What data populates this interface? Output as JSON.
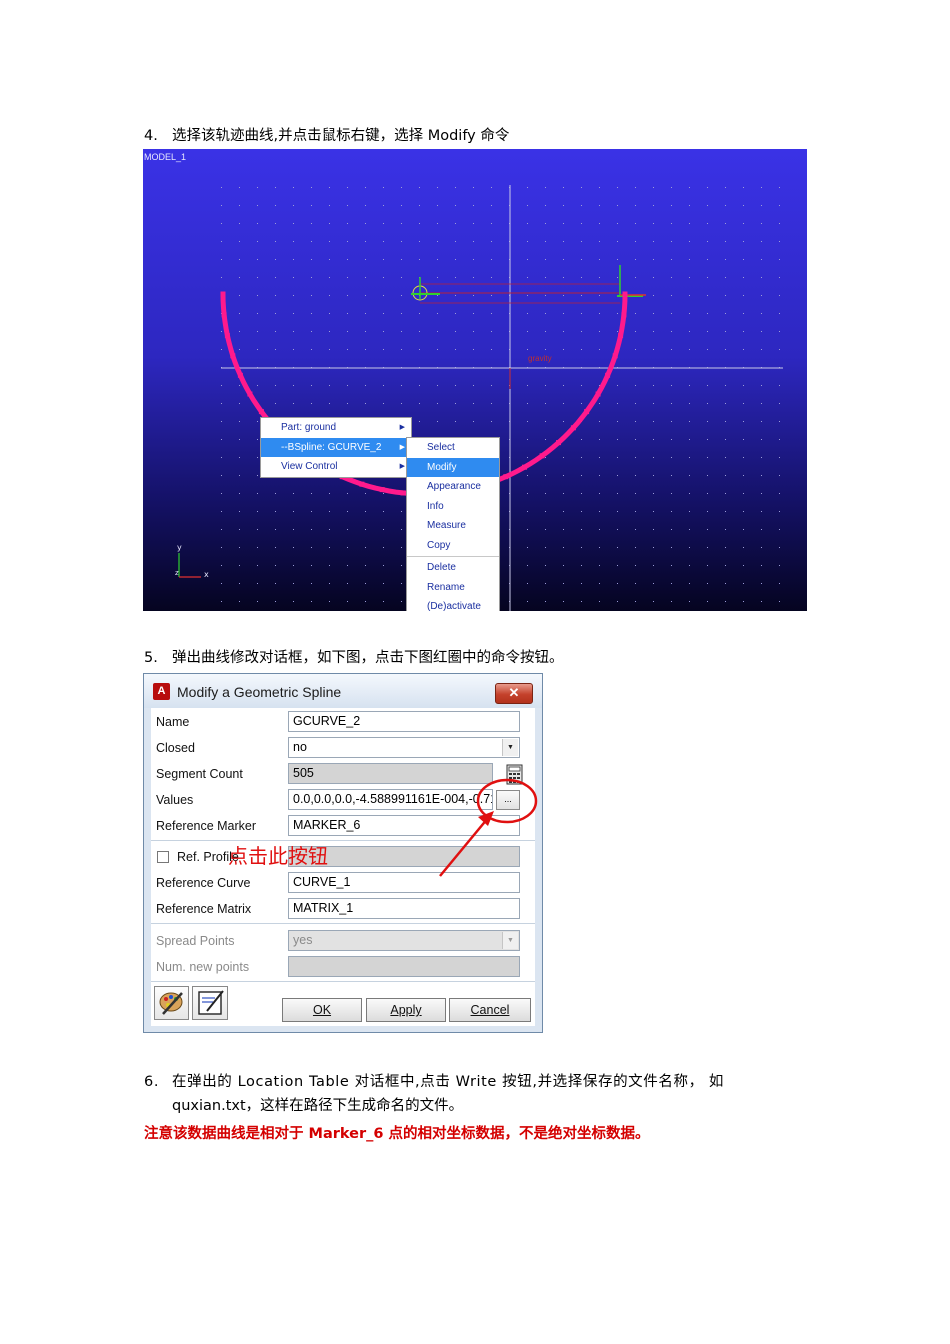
{
  "step4": {
    "num": "4.",
    "text": "选择该轨迹曲线,并点击鼠标右键，选择 Modify 命令"
  },
  "viewport": {
    "model_label": "MODEL_1",
    "gravity_label": "gravity",
    "axis_y": "y",
    "axis_x": "x",
    "axis_z": "z",
    "colors": {
      "curve": "#ff1a8c",
      "background_top": "#3a32e6",
      "background_bottom": "#050420",
      "highlight": "#2f8bf0"
    }
  },
  "context_menu": {
    "items": [
      {
        "label": "Part: ground"
      },
      {
        "label": "--BSpline: GCURVE_2"
      },
      {
        "label": "View Control"
      }
    ],
    "submenu": [
      "Select",
      "Modify",
      "Appearance",
      "Info",
      "Measure",
      "Copy",
      "Delete",
      "Rename",
      "(De)activate"
    ]
  },
  "step5": {
    "num": "5.",
    "text": "弹出曲线修改对话框，如下图，点击下图红圈中的命令按钮。"
  },
  "dialog": {
    "icon_letter": "A",
    "title": "Modify a Geometric Spline",
    "close": "✕",
    "fields": {
      "name_label": "Name",
      "name_value": "GCURVE_2",
      "closed_label": "Closed",
      "closed_value": "no",
      "segment_label": "Segment Count",
      "segment_value": "505",
      "values_label": "Values",
      "values_value": "0.0,0.0,0.0,-4.588991161E-004,-0.71",
      "refmarker_label": "Reference Marker",
      "refmarker_value": "MARKER_6",
      "refprofile_label": "Ref. Profile",
      "refcurve_label": "Reference Curve",
      "refcurve_value": "CURVE_1",
      "refmatrix_label": "Reference Matrix",
      "refmatrix_value": "MATRIX_1",
      "spread_label": "Spread Points",
      "spread_value": "yes",
      "numnew_label": "Num. new points"
    },
    "browse_glyph": "...",
    "buttons": {
      "ok": "OK",
      "apply": "Apply",
      "cancel": "Cancel"
    }
  },
  "annotation": {
    "text": "点击此按钮",
    "color": "#e01010"
  },
  "step6": {
    "num": "6.",
    "line1": "在弹出的 Location Table 对话框中,点击 Write 按钮,并选择保存的文件名称， 如",
    "line2": "quxian.txt，这样在路径下生成命名的文件。"
  },
  "note": {
    "text": "注意该数据曲线是相对于 Marker_6 点的相对坐标数据，不是绝对坐标数据。",
    "color": "#d40000"
  }
}
